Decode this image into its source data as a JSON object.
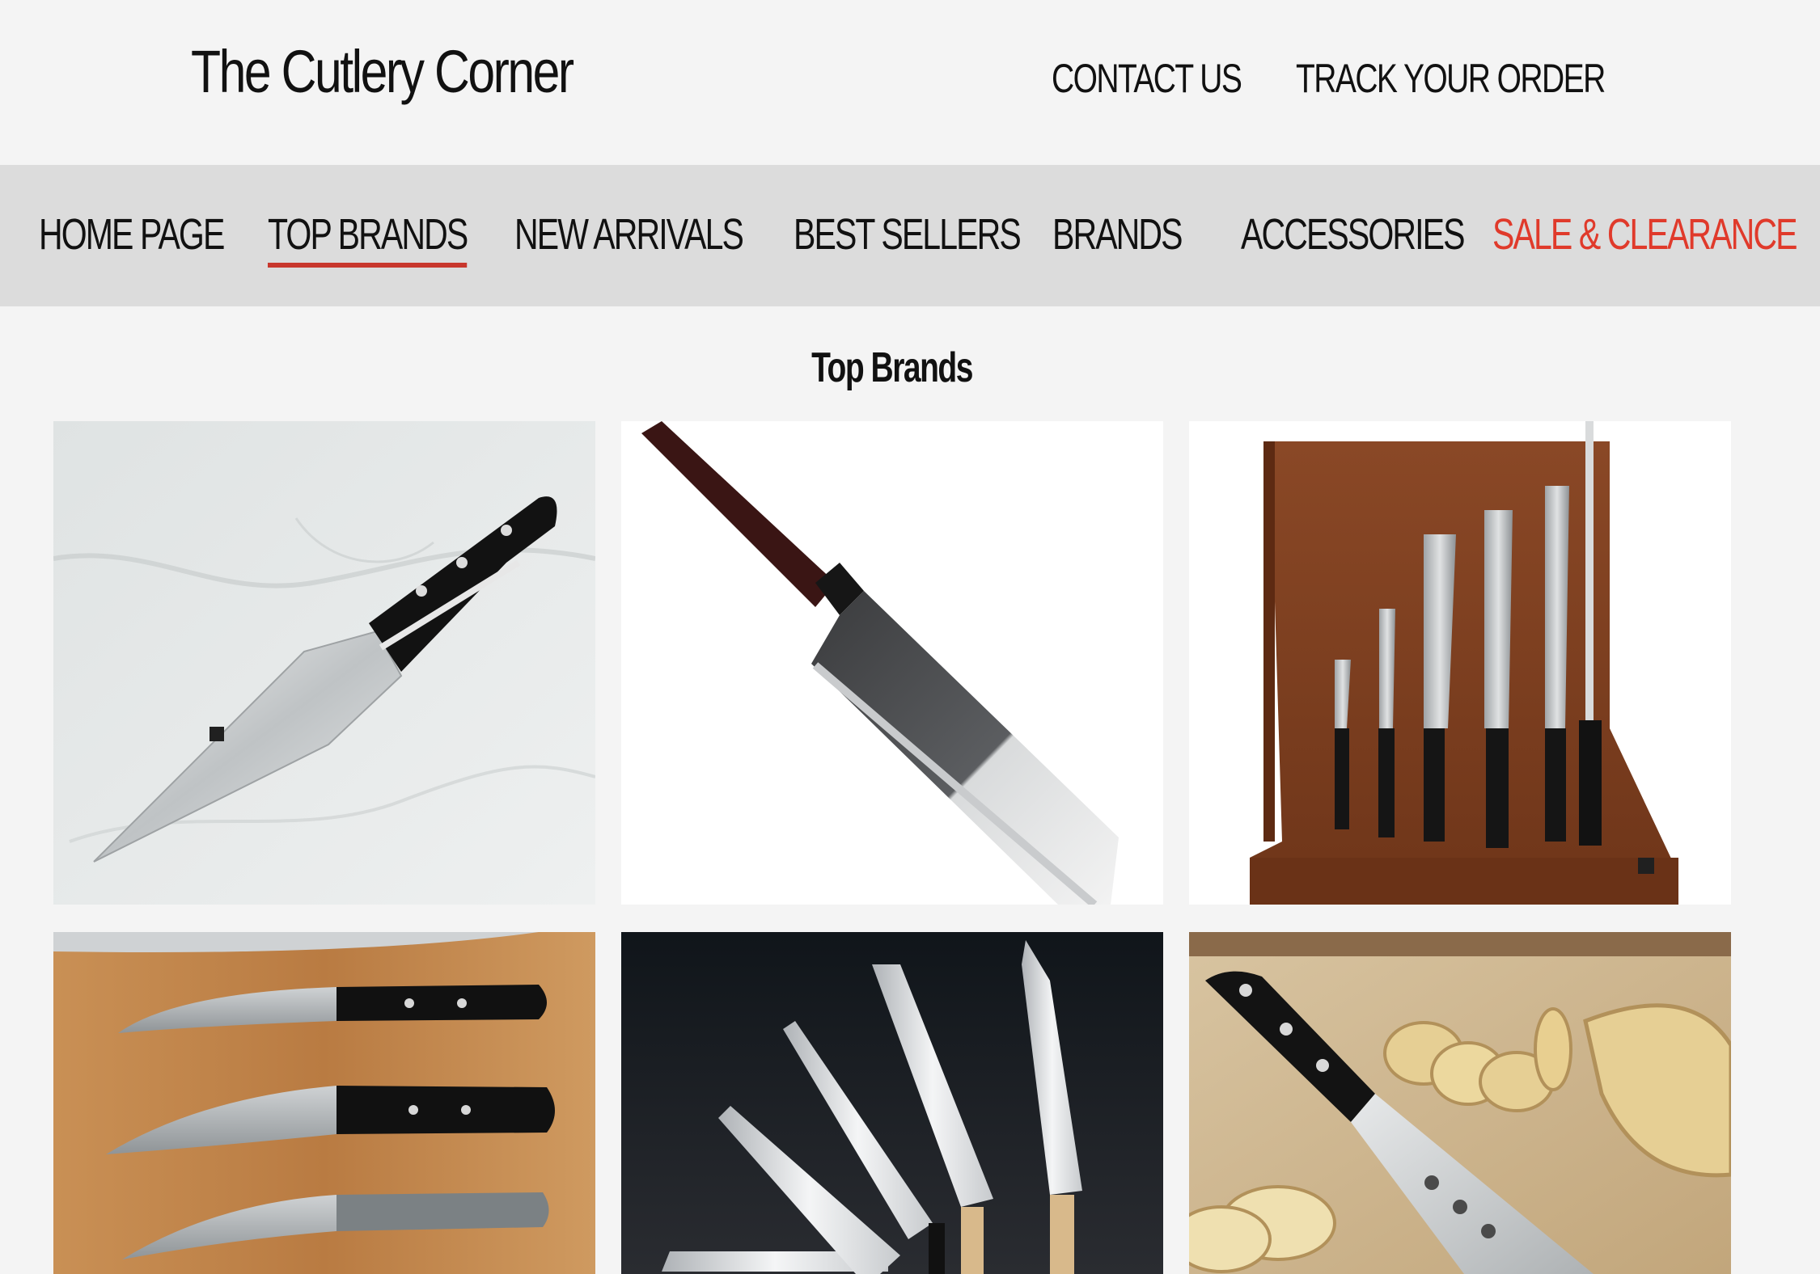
{
  "header": {
    "site_title": "The Cutlery Corner",
    "links": {
      "contact": "CONTACT US",
      "track": "TRACK YOUR ORDER"
    }
  },
  "nav": {
    "items": [
      {
        "label": "HOME PAGE"
      },
      {
        "label": "TOP BRANDS",
        "active": true
      },
      {
        "label": "NEW ARRIVALS"
      },
      {
        "label": "BEST SELLERS"
      },
      {
        "label": "BRANDS"
      },
      {
        "label": "ACCESSORIES"
      },
      {
        "label": "SALE & CLEARANCE",
        "highlight_color": "#e03a2b"
      }
    ],
    "active_underline_color": "#c8372d"
  },
  "main": {
    "section_title": "Top Brands",
    "tiles": [
      {
        "image": "chef-knife-on-marble"
      },
      {
        "image": "japanese-bunka-knife"
      },
      {
        "image": "damascus-knife-block-set"
      },
      {
        "image": "three-knives-on-cutting-board"
      },
      {
        "image": "japanese-knife-fan-dark"
      },
      {
        "image": "chef-knife-cutting-potatoes"
      }
    ]
  },
  "colors": {
    "page_bg": "#f4f4f4",
    "nav_bg": "#dcdcdc",
    "sale": "#e03a2b"
  }
}
